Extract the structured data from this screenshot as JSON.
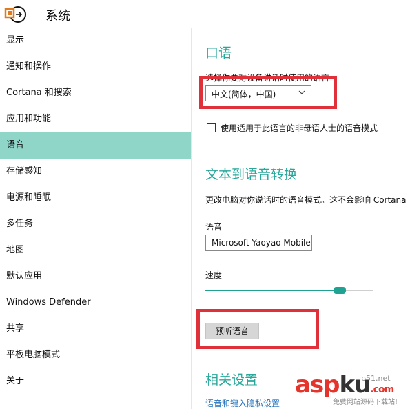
{
  "window": {
    "title": "系统"
  },
  "sidebar": {
    "items": [
      {
        "label": "显示"
      },
      {
        "label": "通知和操作"
      },
      {
        "label": "Cortana 和搜索"
      },
      {
        "label": "应用和功能"
      },
      {
        "label": "语音",
        "selected": true
      },
      {
        "label": "存储感知"
      },
      {
        "label": "电源和睡眠"
      },
      {
        "label": "多任务"
      },
      {
        "label": "地图"
      },
      {
        "label": "默认应用"
      },
      {
        "label": "Windows Defender"
      },
      {
        "label": "共享"
      },
      {
        "label": "平板电脑模式"
      },
      {
        "label": "关于"
      }
    ]
  },
  "speech": {
    "heading": "口语",
    "language_label": "选择你要对设备讲话时使用的语言",
    "language_value": "中文(简体，中国)",
    "nonnative_label": "使用适用于此语言的非母语人士的语音模式",
    "nonnative_checked": false
  },
  "tts": {
    "heading": "文本到语音转换",
    "description": "更改电脑对你说话时的语音模式。这不会影响 Cortana",
    "voice_label": "语音",
    "voice_value": "Microsoft Yaoyao Mobile",
    "speed_label": "速度",
    "speed_value": 0.8,
    "preview_button": "预听语音"
  },
  "related": {
    "heading": "相关设置",
    "privacy_link": "语音和键入隐私设置"
  },
  "watermark": {
    "brand_left": "asp",
    "brand_right": "ku",
    "brand_com": ".com",
    "domain_fragment": "jb51.net",
    "tagline": "免费网站源码下载站!"
  },
  "colors": {
    "accent": "#1fa291",
    "selected_nav": "#8fd6c9",
    "highlight": "#e0303a",
    "link": "#1f6fb8"
  }
}
